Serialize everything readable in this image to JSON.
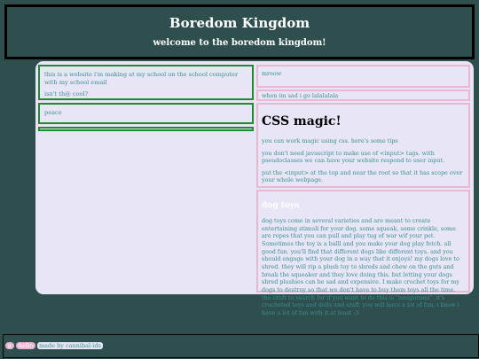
{
  "header": {
    "title": "Boredom Kingdom",
    "subtitle": "welcome to the boredom kingdom!"
  },
  "left": {
    "intro_line1": "this is a website i'm making at my school on the school computer with my school email",
    "intro_line2": "isn't th@ cool?",
    "peace": "peace"
  },
  "right": {
    "meow": "mreow",
    "sad": "when im sad i go lalalalala",
    "css": {
      "title": "CSS magic!",
      "p1": "you can work magic using css. here's some tips",
      "p2": "you don't need javascript to make use of <input> tags. with pseudoclasses we can have your website respond to user input.",
      "p3": "put the <input> at the top and near the root so that it has scope over your whole webpage."
    },
    "dog": {
      "title": "dog toys",
      "body": "dog toys come in several varieties and are meant to create entertaining stimuli for your dog. some squeak, some crinkle, some are ropes that you can pull and play tug of war wif your pet. Sometimes the toy is a balll and you make your dog play fetch. all good fun. you'll find that different dogs like different toys. and you should engage with your dog in a way that it enjoys! my dogs love to shred. they will rip a plush toy to shreds and chew on the guts and break the squeaker and they love doing this. but letting your dogs shred plushies can be sad and expensive. I make crochet toys for my dogs to destroy so that we don't have to buy them toys all the time. the craft to search for if you want to do this is \"amigurumi\". it's crocheted toys and dolls and stuff. you will have a lot of fun, i know i have a lot of fun with it at least :3"
    }
  },
  "footer": {
    "pill1": "a",
    "pill2": "hello",
    "credit": "made by cannibal-ids"
  }
}
